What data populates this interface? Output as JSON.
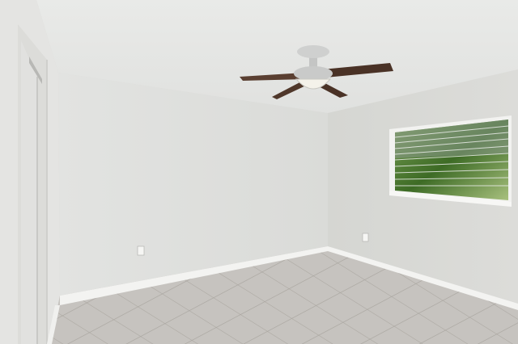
{
  "scene": {
    "kind": "empty-room-photo",
    "elements": [
      "textured-ceiling",
      "ceiling-fan",
      "light-fixture",
      "back-wall",
      "right-wall",
      "left-wall",
      "closet-door",
      "window",
      "tile-floor",
      "baseboards",
      "electrical-outlets"
    ]
  },
  "palette": {
    "ceiling": "#e7e8e6",
    "back_wall": "#dfe0dd",
    "right_wall": "#d8d9d5",
    "left_wall": "#e3e3e1",
    "floor": "#c3c0bc",
    "grout": "#aeaaa5",
    "baseboard": "#f4f4f2",
    "fan_blade": "#4a3226",
    "fan_metal": "#bfc0bf",
    "window_foliage": "#4f7a32"
  }
}
